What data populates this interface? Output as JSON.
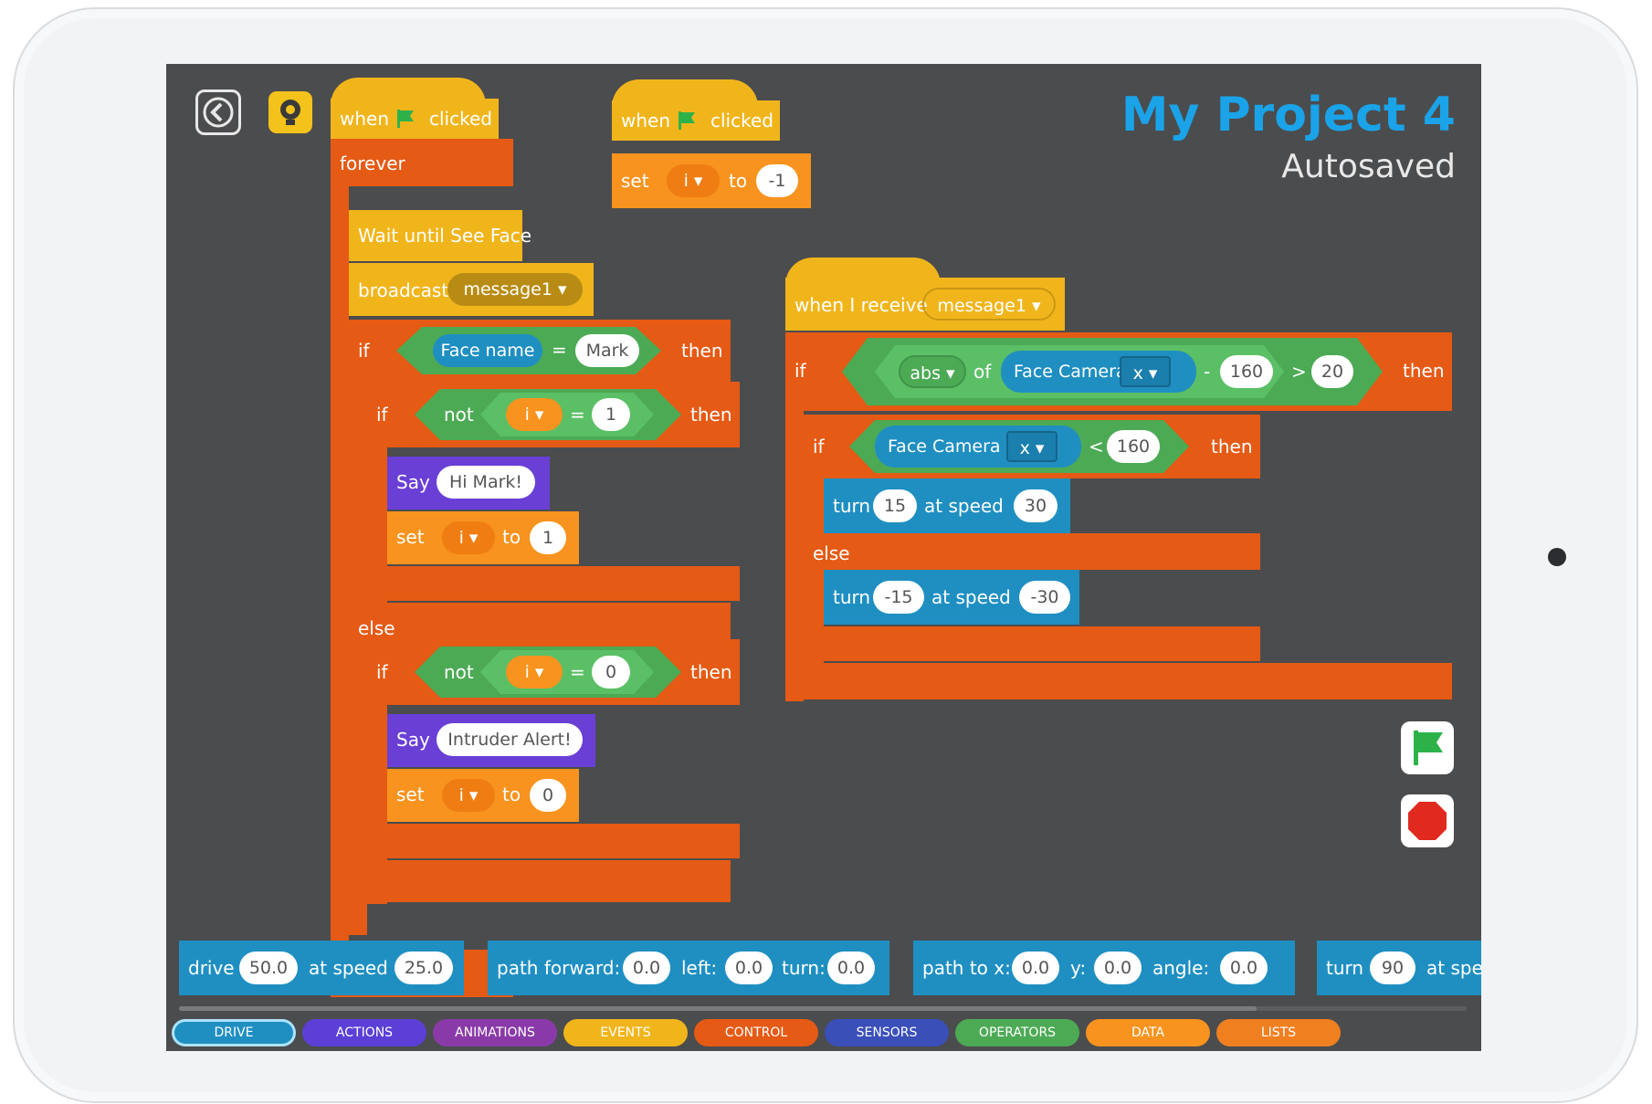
{
  "project": {
    "title": "My Project 4",
    "status": "Autosaved"
  },
  "colors": {
    "control": "#e55a15",
    "events": "#f1b51c",
    "data": "#f7931e",
    "looks": "#6a3fd6",
    "operators": "#4caa55",
    "drive": "#1f8fc2",
    "title": "#1aa3e8"
  },
  "icons": {
    "back": "chevron-left-icon",
    "hint": "lightbulb-icon",
    "flag": "green-flag-icon",
    "stop": "stop-sign-icon"
  },
  "script1": {
    "hat": {
      "when": "when",
      "clicked": "clicked"
    },
    "forever": "forever",
    "wait": "Wait until See Face",
    "broadcast": {
      "label": "broadcast",
      "value": "message1"
    },
    "if1": {
      "if": "if",
      "left": "Face name",
      "op": "=",
      "right": "Mark",
      "then": "then"
    },
    "if2": {
      "if": "if",
      "not": "not",
      "var": "i",
      "op": "=",
      "right": "1",
      "then": "then"
    },
    "say1": {
      "label": "Say",
      "value": "Hi Mark!"
    },
    "set1": {
      "label": "set",
      "var": "i",
      "to": "to",
      "value": "1"
    },
    "else": "else",
    "if3": {
      "if": "if",
      "not": "not",
      "var": "i",
      "op": "=",
      "right": "0",
      "then": "then"
    },
    "say2": {
      "label": "Say",
      "value": "Intruder Alert!"
    },
    "set2": {
      "label": "set",
      "var": "i",
      "to": "to",
      "value": "0"
    }
  },
  "script2": {
    "hat": {
      "when": "when",
      "clicked": "clicked"
    },
    "set": {
      "label": "set",
      "var": "i",
      "to": "to",
      "value": "-1"
    }
  },
  "script3": {
    "hat": {
      "label": "when I receive",
      "value": "message1"
    },
    "if1": {
      "if": "if",
      "abs": "abs",
      "of": "of",
      "sensor": "Face Camera",
      "axis": "x",
      "minus": "-",
      "num": "160",
      "gt": ">",
      "limit": "20",
      "then": "then"
    },
    "if2": {
      "if": "if",
      "sensor": "Face Camera",
      "axis": "x",
      "lt": "<",
      "num": "160",
      "then": "then"
    },
    "turn1": {
      "turn": "turn",
      "deg": "15",
      "at": "at speed",
      "speed": "30"
    },
    "else": "else",
    "turn2": {
      "turn": "turn",
      "deg": "-15",
      "at": "at speed",
      "speed": "-30"
    }
  },
  "palette": [
    {
      "a": "drive",
      "v1": "50.0",
      "b": "at speed",
      "v2": "25.0"
    },
    {
      "a": "path forward:",
      "v1": "0.0",
      "b": "left:",
      "v2": "0.0",
      "c": "turn:",
      "v3": "0.0"
    },
    {
      "a": "path to x:",
      "v1": "0.0",
      "b": "y:",
      "v2": "0.0",
      "c": "angle:",
      "v3": "0.0"
    },
    {
      "a": "turn",
      "v1": "90",
      "b": "at speed"
    }
  ],
  "tabs": [
    {
      "label": "DRIVE",
      "color": "#1f8fc2"
    },
    {
      "label": "ACTIONS",
      "color": "#5b3fd6"
    },
    {
      "label": "ANIMATIONS",
      "color": "#8a3aa8"
    },
    {
      "label": "EVENTS",
      "color": "#f1b51c"
    },
    {
      "label": "CONTROL",
      "color": "#e55a15"
    },
    {
      "label": "SENSORS",
      "color": "#3a4fb8"
    },
    {
      "label": "OPERATORS",
      "color": "#4caa55"
    },
    {
      "label": "DATA",
      "color": "#f7931e"
    },
    {
      "label": "LISTS",
      "color": "#f07f20"
    }
  ]
}
